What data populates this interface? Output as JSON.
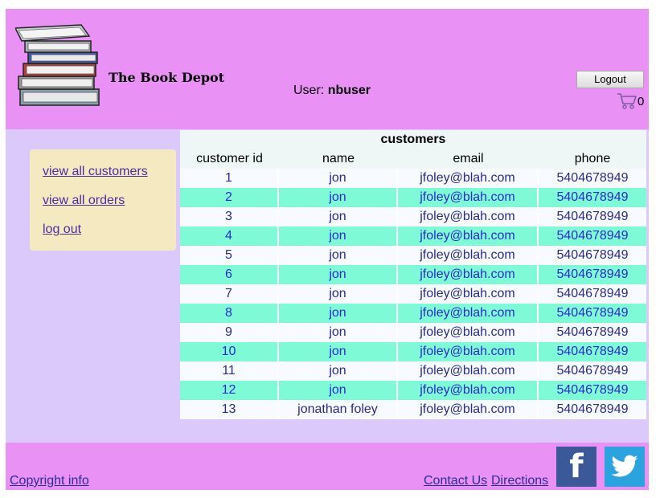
{
  "header": {
    "site_title": "The Book Depot",
    "user_label": "User:",
    "username": "nbuser",
    "logout_label": "Logout",
    "cart_count": "0"
  },
  "sidebar": {
    "items": [
      {
        "label": "view all customers"
      },
      {
        "label": "view all orders"
      },
      {
        "label": "log out"
      }
    ]
  },
  "customers_table": {
    "caption": "customers",
    "columns": [
      "customer id",
      "name",
      "email",
      "phone"
    ],
    "rows": [
      [
        "1",
        "jon",
        "jfoley@blah.com",
        "5404678949"
      ],
      [
        "2",
        "jon",
        "jfoley@blah.com",
        "5404678949"
      ],
      [
        "3",
        "jon",
        "jfoley@blah.com",
        "5404678949"
      ],
      [
        "4",
        "jon",
        "jfoley@blah.com",
        "5404678949"
      ],
      [
        "5",
        "jon",
        "jfoley@blah.com",
        "5404678949"
      ],
      [
        "6",
        "jon",
        "jfoley@blah.com",
        "5404678949"
      ],
      [
        "7",
        "jon",
        "jfoley@blah.com",
        "5404678949"
      ],
      [
        "8",
        "jon",
        "jfoley@blah.com",
        "5404678949"
      ],
      [
        "9",
        "jon",
        "jfoley@blah.com",
        "5404678949"
      ],
      [
        "10",
        "jon",
        "jfoley@blah.com",
        "5404678949"
      ],
      [
        "11",
        "jon",
        "jfoley@blah.com",
        "5404678949"
      ],
      [
        "12",
        "jon",
        "jfoley@blah.com",
        "5404678949"
      ],
      [
        "13",
        "jonathan foley",
        "jfoley@blah.com",
        "5404678949"
      ]
    ]
  },
  "footer": {
    "copyright_label": "Copyright info",
    "contact_label": "Contact Us",
    "directions_label": "Directions",
    "facebook_icon": "facebook-icon",
    "twitter_icon": "twitter-icon"
  },
  "colors": {
    "header_bg": "#e991f4",
    "main_bg": "#dcc9fc",
    "menu_bg": "#f5e9c1",
    "row_alt": "#7ffad6",
    "facebook": "#3b5998",
    "twitter": "#2aa3df"
  }
}
